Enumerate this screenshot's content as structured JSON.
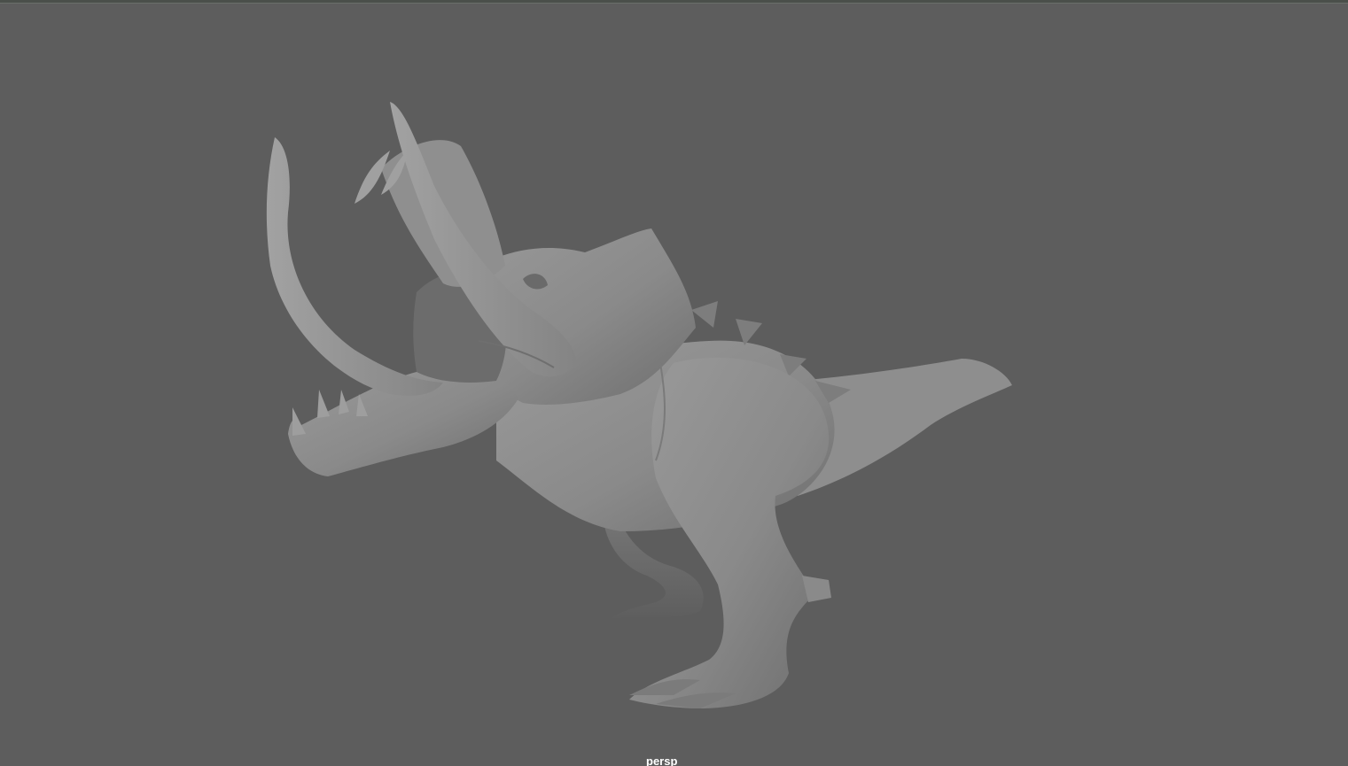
{
  "viewport": {
    "camera_name": "persp",
    "background_color": "#5d5d5d",
    "model": {
      "icon": "creature-mesh-icon",
      "shade_color": "#8c8c8c"
    }
  }
}
